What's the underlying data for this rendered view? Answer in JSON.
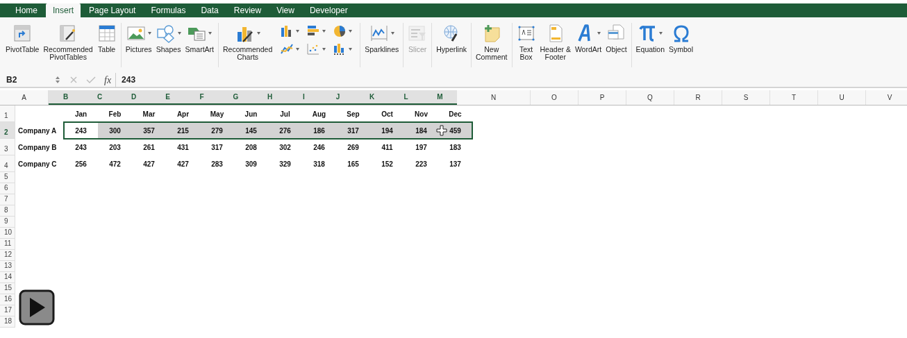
{
  "tabs": [
    {
      "label": "Home",
      "selected": false
    },
    {
      "label": "Insert",
      "selected": true
    },
    {
      "label": "Page Layout",
      "selected": false
    },
    {
      "label": "Formulas",
      "selected": false
    },
    {
      "label": "Data",
      "selected": false
    },
    {
      "label": "Review",
      "selected": false
    },
    {
      "label": "View",
      "selected": false
    },
    {
      "label": "Developer",
      "selected": false
    }
  ],
  "ribbon": {
    "groups": [
      {
        "items": [
          {
            "kind": "large",
            "label": "PivotTable",
            "dropdown": false,
            "disabled": false
          },
          {
            "kind": "large",
            "label": "Recommended\nPivotTables",
            "dropdown": false,
            "disabled": false
          },
          {
            "kind": "large",
            "label": "Table",
            "dropdown": false,
            "disabled": false
          }
        ]
      },
      {
        "items": [
          {
            "kind": "large",
            "label": "Pictures",
            "dropdown": true,
            "disabled": false
          },
          {
            "kind": "large",
            "label": "Shapes",
            "dropdown": true,
            "disabled": false
          },
          {
            "kind": "large",
            "label": "SmartArt",
            "dropdown": true,
            "disabled": false
          }
        ]
      },
      {
        "items": [
          {
            "kind": "large",
            "label": "Recommended\nCharts",
            "dropdown": true,
            "disabled": false
          },
          {
            "kind": "small",
            "dropdown": true,
            "disabled": false
          },
          {
            "kind": "small",
            "dropdown": true,
            "disabled": false
          },
          {
            "kind": "small",
            "dropdown": true,
            "disabled": false
          },
          {
            "kind": "small",
            "dropdown": true,
            "disabled": false
          },
          {
            "kind": "small",
            "dropdown": true,
            "disabled": false
          },
          {
            "kind": "small",
            "dropdown": true,
            "disabled": false
          }
        ]
      },
      {
        "items": [
          {
            "kind": "large",
            "label": "Sparklines",
            "dropdown": true,
            "disabled": false
          }
        ]
      },
      {
        "items": [
          {
            "kind": "large",
            "label": "Slicer",
            "dropdown": false,
            "disabled": true
          }
        ]
      },
      {
        "items": [
          {
            "kind": "large",
            "label": "Hyperlink",
            "dropdown": false,
            "disabled": false
          }
        ]
      },
      {
        "items": [
          {
            "kind": "large",
            "label": "New\nComment",
            "dropdown": false,
            "disabled": false
          }
        ]
      },
      {
        "items": [
          {
            "kind": "large",
            "label": "Text\nBox",
            "dropdown": false,
            "disabled": false
          },
          {
            "kind": "large",
            "label": "Header &\nFooter",
            "dropdown": false,
            "disabled": false
          },
          {
            "kind": "large",
            "label": "WordArt",
            "dropdown": true,
            "disabled": false
          },
          {
            "kind": "large",
            "label": "Object",
            "dropdown": false,
            "disabled": false
          }
        ]
      },
      {
        "items": [
          {
            "kind": "large",
            "label": "Equation",
            "dropdown": true,
            "disabled": false
          },
          {
            "kind": "large",
            "label": "Symbol",
            "dropdown": false,
            "disabled": false
          }
        ]
      }
    ]
  },
  "formula_bar": {
    "name_box": "B2",
    "function_symbol": "fx",
    "formula": "243"
  },
  "sheet": {
    "columns": [
      {
        "label": "A",
        "selected": false
      },
      {
        "label": "B",
        "selected": true
      },
      {
        "label": "C",
        "selected": true
      },
      {
        "label": "D",
        "selected": true
      },
      {
        "label": "E",
        "selected": true
      },
      {
        "label": "F",
        "selected": true
      },
      {
        "label": "G",
        "selected": true
      },
      {
        "label": "H",
        "selected": true
      },
      {
        "label": "I",
        "selected": true
      },
      {
        "label": "J",
        "selected": true
      },
      {
        "label": "K",
        "selected": true
      },
      {
        "label": "L",
        "selected": true
      },
      {
        "label": "M",
        "selected": true
      },
      {
        "label": "N",
        "selected": false
      },
      {
        "label": "O",
        "selected": false
      },
      {
        "label": "P",
        "selected": false
      },
      {
        "label": "Q",
        "selected": false
      },
      {
        "label": "R",
        "selected": false
      },
      {
        "label": "S",
        "selected": false
      },
      {
        "label": "T",
        "selected": false
      },
      {
        "label": "U",
        "selected": false
      },
      {
        "label": "V",
        "selected": false
      }
    ],
    "rows": [
      {
        "number": "1",
        "selected": false,
        "values": [
          "Jan",
          "Feb",
          "Mar",
          "Apr",
          "May",
          "Jun",
          "Jul",
          "Aug",
          "Sep",
          "Oct",
          "Nov",
          "Dec"
        ]
      },
      {
        "number": "2",
        "selected": true,
        "label": "Company A",
        "values": [
          "243",
          "300",
          "357",
          "215",
          "279",
          "145",
          "276",
          "186",
          "317",
          "194",
          "184",
          "459"
        ]
      },
      {
        "number": "3",
        "selected": false,
        "label": "Company B",
        "values": [
          "243",
          "203",
          "261",
          "431",
          "317",
          "208",
          "302",
          "246",
          "269",
          "411",
          "197",
          "183"
        ]
      },
      {
        "number": "4",
        "selected": false,
        "label": "Company C",
        "values": [
          "256",
          "472",
          "427",
          "427",
          "283",
          "309",
          "329",
          "318",
          "165",
          "152",
          "223",
          "137"
        ]
      },
      {
        "number": "5",
        "selected": false
      },
      {
        "number": "6",
        "selected": false
      },
      {
        "number": "7",
        "selected": false
      },
      {
        "number": "8",
        "selected": false
      },
      {
        "number": "9",
        "selected": false
      },
      {
        "number": "10",
        "selected": false
      },
      {
        "number": "11",
        "selected": false
      },
      {
        "number": "12",
        "selected": false
      },
      {
        "number": "13",
        "selected": false
      },
      {
        "number": "14",
        "selected": false
      },
      {
        "number": "15",
        "selected": false
      },
      {
        "number": "16",
        "selected": false
      },
      {
        "number": "17",
        "selected": false
      },
      {
        "number": "18",
        "selected": false
      }
    ]
  }
}
